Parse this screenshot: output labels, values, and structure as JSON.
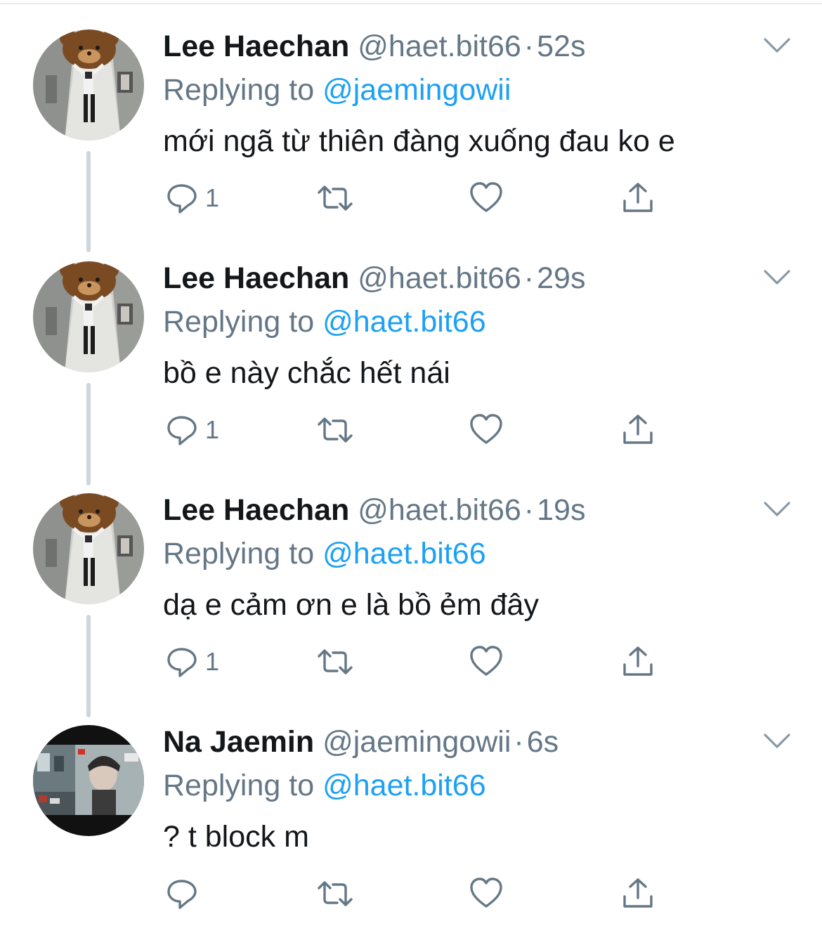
{
  "colors": {
    "text": "#14171a",
    "muted": "#657786",
    "link": "#1da1f2",
    "thread_line": "#ccd6dd"
  },
  "icons": {
    "reply": "reply-icon",
    "retweet": "retweet-icon",
    "like": "heart-icon",
    "share": "share-icon",
    "more": "chevron-down-icon"
  },
  "tweets": [
    {
      "name": "Lee Haechan",
      "handle": "@haet.bit66",
      "separator": "·",
      "time": "52s",
      "replying_prefix": "Replying to",
      "replying_to": "@jaemingowii",
      "text": "mới ngã từ thiên đàng xuống đau ko e",
      "reply_count": "1"
    },
    {
      "name": "Lee Haechan",
      "handle": "@haet.bit66",
      "separator": "·",
      "time": "29s",
      "replying_prefix": "Replying to",
      "replying_to": "@haet.bit66",
      "text": "bồ e này chắc hết nái",
      "reply_count": "1"
    },
    {
      "name": "Lee Haechan",
      "handle": "@haet.bit66",
      "separator": "·",
      "time": "19s",
      "replying_prefix": "Replying to",
      "replying_to": "@haet.bit66",
      "text": "dạ e cảm ơn e là bồ ẻm đây",
      "reply_count": "1"
    },
    {
      "name": "Na Jaemin",
      "handle": "@jaemingowii",
      "separator": "·",
      "time": "6s",
      "replying_prefix": "Replying to",
      "replying_to": "@haet.bit66",
      "text": "? t block m",
      "reply_count": ""
    }
  ]
}
